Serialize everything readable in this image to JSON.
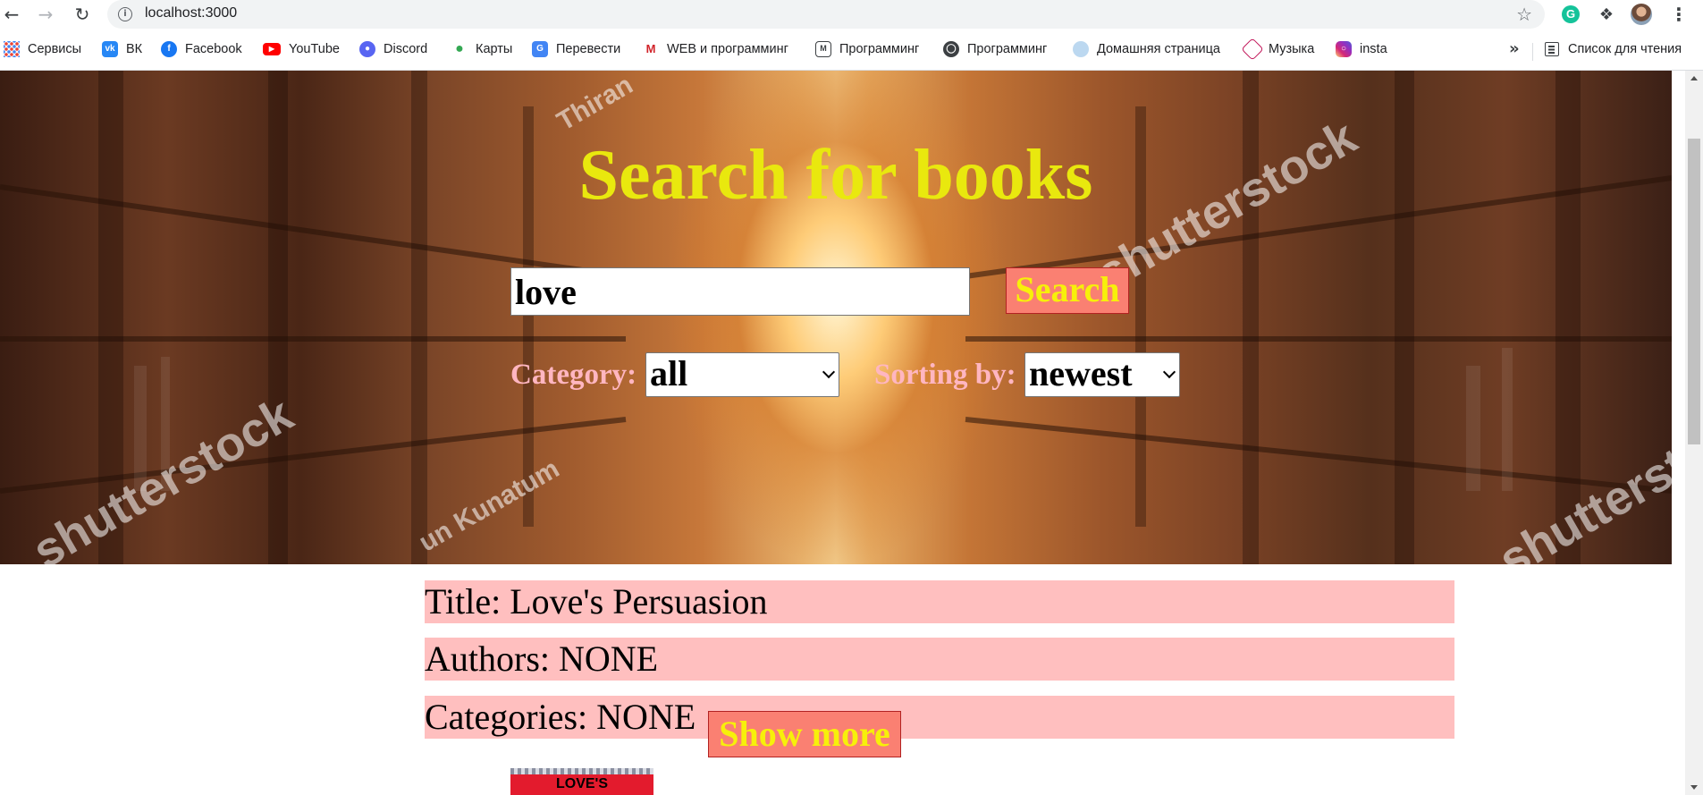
{
  "browser": {
    "url": "localhost:3000",
    "bookmarks": [
      {
        "label": "Сервисы",
        "icon": "apps-grid-icon"
      },
      {
        "label": "ВК",
        "icon": "vk-icon"
      },
      {
        "label": "Facebook",
        "icon": "facebook-icon"
      },
      {
        "label": "YouTube",
        "icon": "youtube-icon"
      },
      {
        "label": "Discord",
        "icon": "discord-icon"
      },
      {
        "label": "Карты",
        "icon": "maps-pin-icon"
      },
      {
        "label": "Перевести",
        "icon": "translate-icon"
      },
      {
        "label": "WEB и программинг",
        "icon": "web-dev-icon"
      },
      {
        "label": "Программинг",
        "icon": "gmail-icon"
      },
      {
        "label": "Программинг",
        "icon": "globe-icon"
      },
      {
        "label": "Домашняя страница",
        "icon": "home-page-icon"
      },
      {
        "label": "Музыка",
        "icon": "music-icon"
      },
      {
        "label": "insta",
        "icon": "instagram-icon"
      }
    ],
    "bookmarks_overflow": "»",
    "reading_list": "Список для чтения"
  },
  "page": {
    "title": "Search for books",
    "search": {
      "value": "love",
      "button": "Search"
    },
    "category": {
      "label": "Category:",
      "selected": "all"
    },
    "sorting": {
      "label": "Sorting by:",
      "selected": "newest"
    },
    "watermark": {
      "brand": "shutterstock",
      "author_1": "Thiran",
      "author_2": "un Kunatum"
    },
    "result": {
      "title": "Title: Love's Persuasion",
      "authors": "Authors: NONE",
      "categories": "Categories: NONE",
      "show_more": "Show more",
      "cover_text": "LOVE'S"
    }
  },
  "colors": {
    "title_yellow": "#e9e80e",
    "button_salmon": "#fa8072",
    "label_pink": "#ffb6c1",
    "result_bg": "#ffbfbf"
  }
}
